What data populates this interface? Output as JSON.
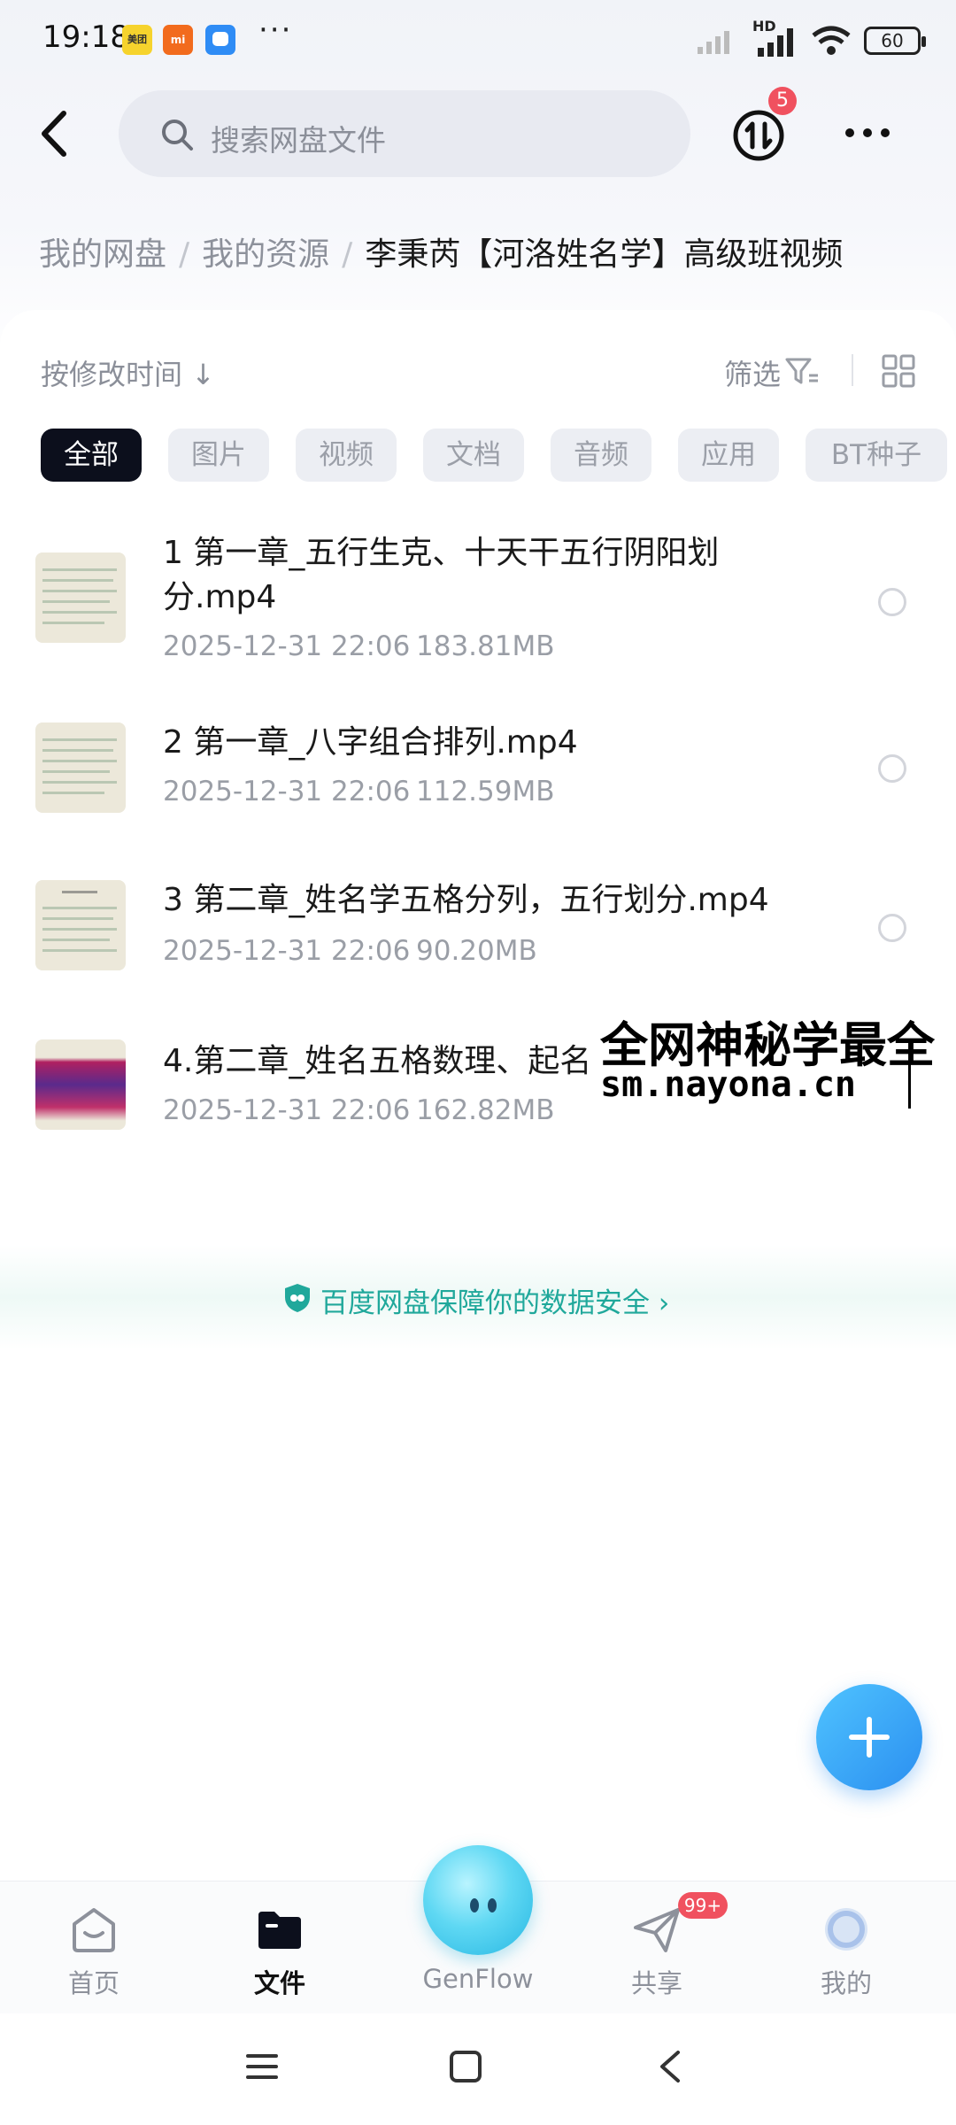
{
  "status_bar": {
    "time": "19:18",
    "apps": [
      {
        "name": "meituan",
        "label": "美团",
        "color": "#f6d32d"
      },
      {
        "name": "mi",
        "label": "mi",
        "color": "#f26b1d"
      },
      {
        "name": "chat",
        "label": "",
        "color": "#2f8cf5"
      }
    ],
    "more": "···",
    "network": "HD",
    "battery": "60"
  },
  "header": {
    "search_placeholder": "搜索网盘文件",
    "transfer_badge": "5"
  },
  "breadcrumb": {
    "items": [
      "我的网盘",
      "我的资源"
    ],
    "current": "李秉芮【河洛姓名学】高级班视频"
  },
  "toolbar": {
    "sort_label": "按修改时间 ↓",
    "filter_label": "筛选"
  },
  "filters": {
    "tabs": [
      "全部",
      "图片",
      "视频",
      "文档",
      "音频",
      "应用",
      "BT种子"
    ],
    "active": "全部"
  },
  "files": [
    {
      "name_line1": "1 第一章_五行生克、十天干五行阴阳划",
      "name_line2": "分.mp4",
      "date": "2025-12-31  22:06",
      "size": "183.81MB"
    },
    {
      "name_line1": "2 第一章_八字组合排列.mp4",
      "name_line2": "",
      "date": "2025-12-31  22:06",
      "size": "112.59MB"
    },
    {
      "name_line1": "3 第二章_姓名学五格分列，五行划分.mp4",
      "name_line2": "",
      "date": "2025-12-31  22:06",
      "size": "90.20MB"
    },
    {
      "name_line1": "4.第二章_姓名五格数理、起名",
      "name_line2": "",
      "date": "2025-12-31  22:06",
      "size": "162.82MB"
    }
  ],
  "watermark": {
    "line1": "全网神秘学最全",
    "line2": "sm.nayona.cn"
  },
  "safety": {
    "text": "百度网盘保障你的数据安全",
    "accent": "#20a89b"
  },
  "bottom_nav": {
    "items": [
      {
        "label": "首页",
        "icon": "home-icon"
      },
      {
        "label": "文件",
        "icon": "folder-icon"
      },
      {
        "label": "GenFlow",
        "icon": "genflow-orb-icon"
      },
      {
        "label": "共享",
        "icon": "share-plane-icon",
        "badge": "99+"
      },
      {
        "label": "我的",
        "icon": "profile-icon"
      }
    ],
    "active": "文件"
  },
  "colors": {
    "active_chip": "#0c0f1c",
    "fab": "#2b8ff0",
    "badge": "#f0515f"
  }
}
